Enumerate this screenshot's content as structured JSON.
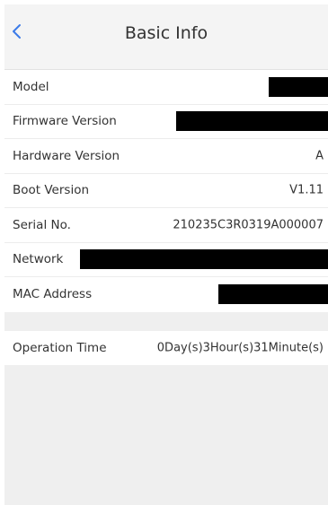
{
  "header": {
    "title": "Basic Info"
  },
  "info": {
    "model_label": "Model",
    "firmware_label": "Firmware Version",
    "hardware_label": "Hardware Version",
    "hardware_value": "A",
    "boot_label": "Boot Version",
    "boot_value": "V1.11",
    "serial_label": "Serial No.",
    "serial_value": "210235C3R0319A000007",
    "network_label": "Network",
    "mac_label": "MAC Address"
  },
  "operation": {
    "label": "Operation Time",
    "value": "0Day(s)3Hour(s)31Minute(s)"
  },
  "colors": {
    "accent": "#3b7be8",
    "background": "#efefef",
    "redaction": "#000000"
  }
}
